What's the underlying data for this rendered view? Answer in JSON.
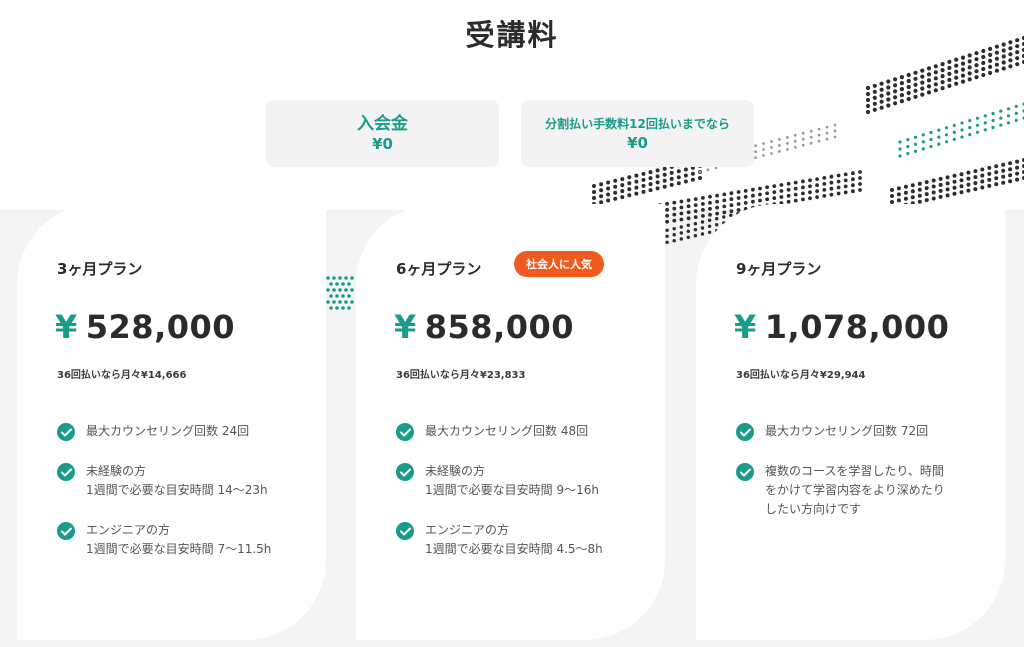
{
  "page": {
    "title": "受講料"
  },
  "fees": {
    "entry": {
      "label": "入会金",
      "value": "¥0"
    },
    "split": {
      "label": "分割払い手数料12回払いまでなら",
      "value": "¥0"
    }
  },
  "colors": {
    "accent": "#1a9c8a",
    "badge": "#f05a1e",
    "text": "#2b2b2b"
  },
  "plans": [
    {
      "name": "3ヶ月プラン",
      "currency": "¥",
      "price": "528,000",
      "monthly": "36回払いなら月々¥14,666",
      "features": [
        {
          "line1": "最大カウンセリング回数 24回",
          "line2": "",
          "line3": ""
        },
        {
          "line1": "未経験の方",
          "line2": "1週間で必要な目安時間 14〜23h",
          "line3": ""
        },
        {
          "line1": "エンジニアの方",
          "line2": "1週間で必要な目安時間 7〜11.5h",
          "line3": ""
        }
      ]
    },
    {
      "name": "6ヶ月プラン",
      "badge": "社会人に人気",
      "currency": "¥",
      "price": "858,000",
      "monthly": "36回払いなら月々¥23,833",
      "features": [
        {
          "line1": "最大カウンセリング回数 48回",
          "line2": "",
          "line3": ""
        },
        {
          "line1": "未経験の方",
          "line2": "1週間で必要な目安時間 9〜16h",
          "line3": ""
        },
        {
          "line1": "エンジニアの方",
          "line2": "1週間で必要な目安時間 4.5〜8h",
          "line3": ""
        }
      ]
    },
    {
      "name": "9ヶ月プラン",
      "currency": "¥",
      "price": "1,078,000",
      "monthly": "36回払いなら月々¥29,944",
      "features": [
        {
          "line1": "最大カウンセリング回数 72回",
          "line2": "",
          "line3": ""
        },
        {
          "line1": "複数のコースを学習したり、時間",
          "line2": "をかけて学習内容をより深めたり",
          "line3": "したい方向けです"
        }
      ]
    }
  ],
  "icons": {
    "check": "check-circle-icon",
    "decoration": "dot-pattern"
  }
}
